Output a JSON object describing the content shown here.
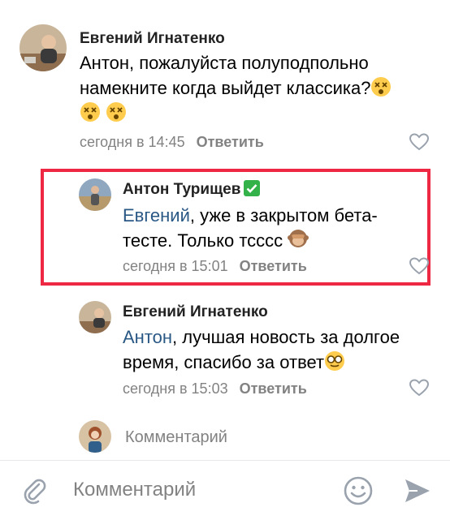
{
  "comments": [
    {
      "author": "Евгений Игнатенко",
      "text_lines": [
        "Антон, пожалуйста полуподпольно",
        "намекните когда выйдет классика?"
      ],
      "emojis": [
        "dizzy-face",
        "dizzy-face",
        "dizzy-face"
      ],
      "time": "сегодня в 14:45",
      "reply_label": "Ответить"
    },
    {
      "author": "Антон Турищев",
      "verified_icon": "check-mark-button-icon",
      "mention": "Евгений",
      "text_line1": ", уже в закрытом бета-",
      "text_line2": "тесте. Только тсссс",
      "emoji": "see-no-evil-monkey",
      "time": "сегодня в 15:01",
      "reply_label": "Ответить"
    },
    {
      "author": "Евгений Игнатенко",
      "mention": "Антон",
      "text_line1": ", лучшая новость за долгое",
      "text_line2": "время, спасибо за ответ",
      "emoji": "nerd-face",
      "time": "сегодня в 15:03",
      "reply_label": "Ответить"
    }
  ],
  "reply_input": {
    "placeholder": "Комментарий"
  },
  "bottom_bar": {
    "placeholder": "Комментарий",
    "icons": [
      "paperclip-icon",
      "smiley-icon",
      "send-icon"
    ]
  },
  "colors": {
    "highlight": "#ee2743",
    "mention": "#2a5885",
    "muted": "#828282"
  }
}
